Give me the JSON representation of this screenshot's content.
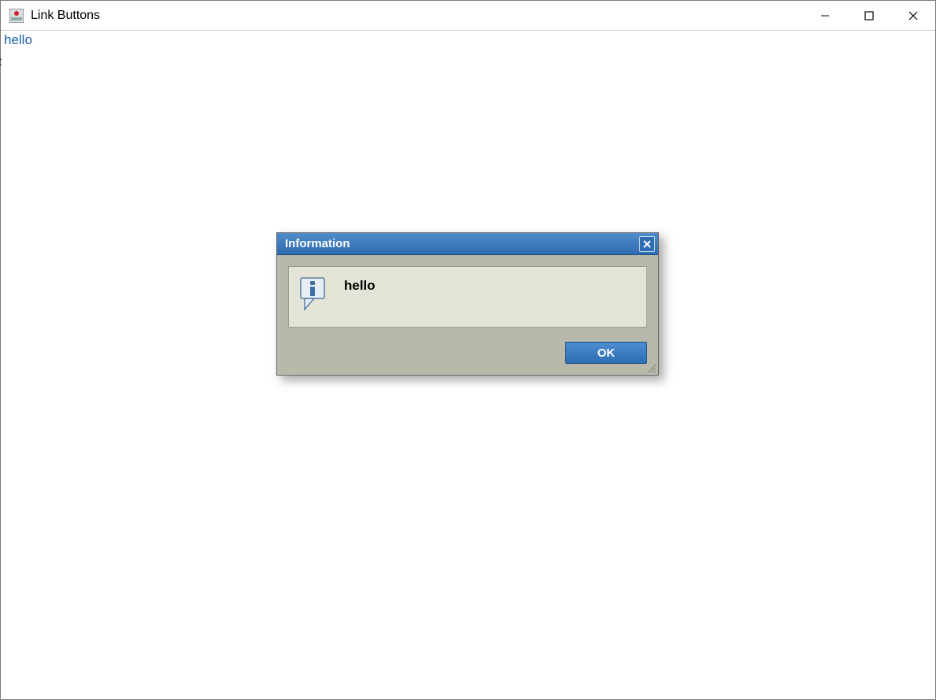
{
  "window": {
    "title": "Link Buttons"
  },
  "content": {
    "link_label": "hello",
    "edge_stub": "t"
  },
  "dialog": {
    "title": "Information",
    "message": "hello",
    "ok_label": "OK"
  }
}
